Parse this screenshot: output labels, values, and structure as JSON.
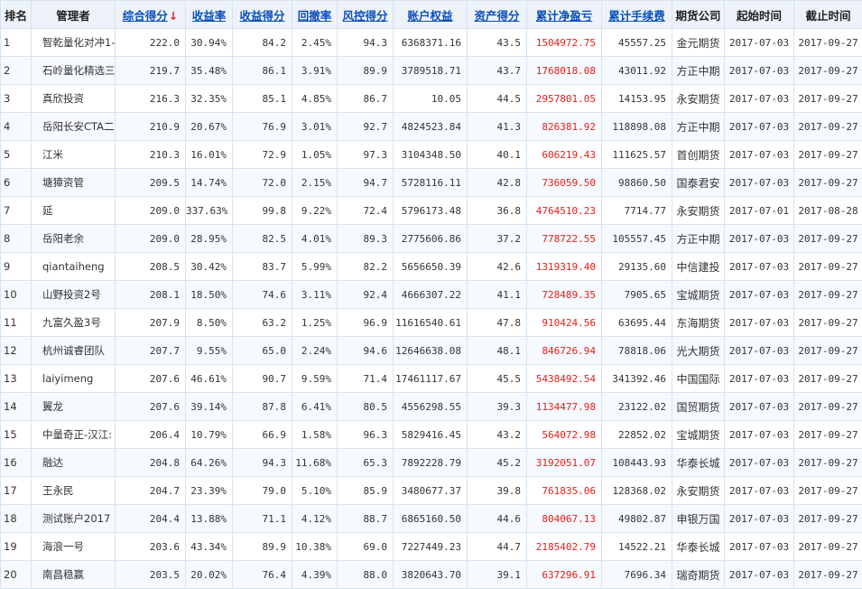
{
  "headers": {
    "rank": "排名",
    "manager": "管理者",
    "total_score": "综合得分",
    "return_rate": "收益率",
    "return_score": "收益得分",
    "drawdown": "回撤率",
    "risk_score": "风控得分",
    "equity": "账户权益",
    "asset_score": "资产得分",
    "net_profit": "累计净盈亏",
    "fees": "累计手续费",
    "broker": "期货公司",
    "start": "起始时间",
    "end": "截止时间"
  },
  "sort_arrow": "↓",
  "accent_red": "#e0201d",
  "link_blue": "#0b4fb8",
  "rows": [
    {
      "rank": "1",
      "manager": "智乾量化对冲1-",
      "total": "222.0",
      "ret": "30.94%",
      "rs": "84.2",
      "dd": "2.45%",
      "risk": "94.3",
      "eq": "6368371.16",
      "as": "43.5",
      "np": "1504972.75",
      "fee": "45557.25",
      "co": "金元期货",
      "start": "2017-07-03",
      "end": "2017-09-27"
    },
    {
      "rank": "2",
      "manager": "石岭量化精选三",
      "total": "219.7",
      "ret": "35.48%",
      "rs": "86.1",
      "dd": "3.91%",
      "risk": "89.9",
      "eq": "3789518.71",
      "as": "43.7",
      "np": "1768018.08",
      "fee": "43011.92",
      "co": "方正中期",
      "start": "2017-07-03",
      "end": "2017-09-27"
    },
    {
      "rank": "3",
      "manager": "真欣投资",
      "total": "216.3",
      "ret": "32.35%",
      "rs": "85.1",
      "dd": "4.85%",
      "risk": "86.7",
      "eq": "10.05",
      "as": "44.5",
      "np": "2957801.05",
      "fee": "14153.95",
      "co": "永安期货",
      "start": "2017-07-03",
      "end": "2017-09-27"
    },
    {
      "rank": "4",
      "manager": "岳阳长安CTA二-",
      "total": "210.9",
      "ret": "20.67%",
      "rs": "76.9",
      "dd": "3.01%",
      "risk": "92.7",
      "eq": "4824523.84",
      "as": "41.3",
      "np": "826381.92",
      "fee": "118898.08",
      "co": "方正中期",
      "start": "2017-07-03",
      "end": "2017-09-27"
    },
    {
      "rank": "5",
      "manager": "江米",
      "total": "210.3",
      "ret": "16.01%",
      "rs": "72.9",
      "dd": "1.05%",
      "risk": "97.3",
      "eq": "3104348.50",
      "as": "40.1",
      "np": "606219.43",
      "fee": "111625.57",
      "co": "首创期货",
      "start": "2017-07-03",
      "end": "2017-09-27"
    },
    {
      "rank": "6",
      "manager": "塘獐资管",
      "total": "209.5",
      "ret": "14.74%",
      "rs": "72.0",
      "dd": "2.15%",
      "risk": "94.7",
      "eq": "5728116.11",
      "as": "42.8",
      "np": "736059.50",
      "fee": "98860.50",
      "co": "国泰君安",
      "start": "2017-07-03",
      "end": "2017-09-27"
    },
    {
      "rank": "7",
      "manager": "延",
      "total": "209.0",
      "ret": "337.63%",
      "rs": "99.8",
      "dd": "9.22%",
      "risk": "72.4",
      "eq": "5796173.48",
      "as": "36.8",
      "np": "4764510.23",
      "fee": "7714.77",
      "co": "永安期货",
      "start": "2017-07-01",
      "end": "2017-08-28"
    },
    {
      "rank": "8",
      "manager": "岳阳老余",
      "total": "209.0",
      "ret": "28.95%",
      "rs": "82.5",
      "dd": "4.01%",
      "risk": "89.3",
      "eq": "2775606.86",
      "as": "37.2",
      "np": "778722.55",
      "fee": "105557.45",
      "co": "方正中期",
      "start": "2017-07-03",
      "end": "2017-09-27"
    },
    {
      "rank": "9",
      "manager": "qiantaiheng",
      "total": "208.5",
      "ret": "30.42%",
      "rs": "83.7",
      "dd": "5.99%",
      "risk": "82.2",
      "eq": "5656650.39",
      "as": "42.6",
      "np": "1319319.40",
      "fee": "29135.60",
      "co": "中信建投",
      "start": "2017-07-03",
      "end": "2017-09-27"
    },
    {
      "rank": "10",
      "manager": "山野投资2号",
      "total": "208.1",
      "ret": "18.50%",
      "rs": "74.6",
      "dd": "3.11%",
      "risk": "92.4",
      "eq": "4666307.22",
      "as": "41.1",
      "np": "728489.35",
      "fee": "7905.65",
      "co": "宝城期货",
      "start": "2017-07-03",
      "end": "2017-09-27"
    },
    {
      "rank": "11",
      "manager": "九富久盈3号",
      "total": "207.9",
      "ret": "8.50%",
      "rs": "63.2",
      "dd": "1.25%",
      "risk": "96.9",
      "eq": "11616540.61",
      "as": "47.8",
      "np": "910424.56",
      "fee": "63695.44",
      "co": "东海期货",
      "start": "2017-07-03",
      "end": "2017-09-27"
    },
    {
      "rank": "12",
      "manager": "杭州诚睿团队",
      "total": "207.7",
      "ret": "9.55%",
      "rs": "65.0",
      "dd": "2.24%",
      "risk": "94.6",
      "eq": "12646638.08",
      "as": "48.1",
      "np": "846726.94",
      "fee": "78818.06",
      "co": "光大期货",
      "start": "2017-07-03",
      "end": "2017-09-27"
    },
    {
      "rank": "13",
      "manager": "laiyimeng",
      "total": "207.6",
      "ret": "46.61%",
      "rs": "90.7",
      "dd": "9.59%",
      "risk": "71.4",
      "eq": "17461117.67",
      "as": "45.5",
      "np": "5438492.54",
      "fee": "341392.46",
      "co": "中国国际",
      "start": "2017-07-03",
      "end": "2017-09-27"
    },
    {
      "rank": "14",
      "manager": "翼龙",
      "total": "207.6",
      "ret": "39.14%",
      "rs": "87.8",
      "dd": "6.41%",
      "risk": "80.5",
      "eq": "4556298.55",
      "as": "39.3",
      "np": "1134477.98",
      "fee": "23122.02",
      "co": "国贸期货",
      "start": "2017-07-03",
      "end": "2017-09-27"
    },
    {
      "rank": "15",
      "manager": "中量奇正-汉江:",
      "total": "206.4",
      "ret": "10.79%",
      "rs": "66.9",
      "dd": "1.58%",
      "risk": "96.3",
      "eq": "5829416.45",
      "as": "43.2",
      "np": "564072.98",
      "fee": "22852.02",
      "co": "宝城期货",
      "start": "2017-07-03",
      "end": "2017-09-27"
    },
    {
      "rank": "16",
      "manager": "融达",
      "total": "204.8",
      "ret": "64.26%",
      "rs": "94.3",
      "dd": "11.68%",
      "risk": "65.3",
      "eq": "7892228.79",
      "as": "45.2",
      "np": "3192051.07",
      "fee": "108443.93",
      "co": "华泰长城",
      "start": "2017-07-03",
      "end": "2017-09-27"
    },
    {
      "rank": "17",
      "manager": "王永民",
      "total": "204.7",
      "ret": "23.39%",
      "rs": "79.0",
      "dd": "5.10%",
      "risk": "85.9",
      "eq": "3480677.37",
      "as": "39.8",
      "np": "761835.06",
      "fee": "128368.02",
      "co": "永安期货",
      "start": "2017-07-03",
      "end": "2017-09-27"
    },
    {
      "rank": "18",
      "manager": "测试账户2017",
      "total": "204.4",
      "ret": "13.88%",
      "rs": "71.1",
      "dd": "4.12%",
      "risk": "88.7",
      "eq": "6865160.50",
      "as": "44.6",
      "np": "804067.13",
      "fee": "49802.87",
      "co": "申银万国",
      "start": "2017-07-03",
      "end": "2017-09-27"
    },
    {
      "rank": "19",
      "manager": "海浪一号",
      "total": "203.6",
      "ret": "43.34%",
      "rs": "89.9",
      "dd": "10.38%",
      "risk": "69.0",
      "eq": "7227449.23",
      "as": "44.7",
      "np": "2185402.79",
      "fee": "14522.21",
      "co": "华泰长城",
      "start": "2017-07-03",
      "end": "2017-09-27"
    },
    {
      "rank": "20",
      "manager": "南昌稳赢",
      "total": "203.5",
      "ret": "20.02%",
      "rs": "76.4",
      "dd": "4.39%",
      "risk": "88.0",
      "eq": "3820643.70",
      "as": "39.1",
      "np": "637296.91",
      "fee": "7696.34",
      "co": "瑞奇期货",
      "start": "2017-07-03",
      "end": "2017-09-27"
    }
  ]
}
